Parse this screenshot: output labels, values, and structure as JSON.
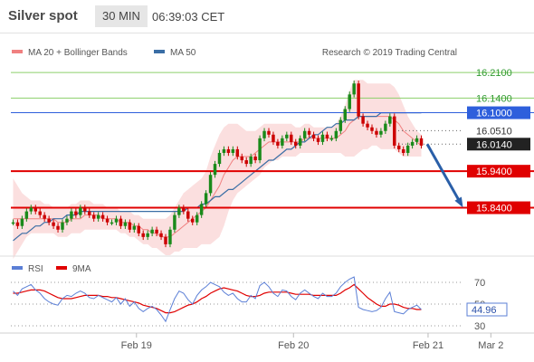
{
  "header": {
    "title": "Silver spot",
    "timeframe": "30 MIN",
    "time": "06:39:03 CET"
  },
  "credit": "Research © 2019 Trading Central",
  "colors": {
    "bollinger": "#f08080",
    "ma50": "#3a6ea5",
    "resistance": "#2e5fdc",
    "support": "#e00000",
    "target_line": "#8ccf6a",
    "candle_up": "#1a8a1a",
    "candle_down": "#cc0000",
    "rsi": "#5b7fd6",
    "rsi_ma": "#e00000"
  },
  "chart_data": [
    {
      "type": "candlestick",
      "legend": [
        {
          "name": "MA 20 + Bollinger Bands",
          "color": "#f08080"
        },
        {
          "name": "MA 50",
          "color": "#3a6ea5"
        }
      ],
      "ylim": [
        15.72,
        16.245
      ],
      "x_ticks": [
        "Feb 19",
        "Feb 20",
        "Feb 21",
        "Mar 2"
      ],
      "levels": [
        {
          "value": 16.21,
          "label": "16.2100",
          "kind": "target"
        },
        {
          "value": 16.14,
          "label": "16.1400",
          "kind": "target"
        },
        {
          "value": 16.1,
          "label": "16.1000",
          "kind": "resistance"
        },
        {
          "value": 16.051,
          "label": "16.0510",
          "kind": "dotted"
        },
        {
          "value": 16.014,
          "label": "16.0140",
          "kind": "last"
        },
        {
          "value": 15.94,
          "label": "15.9400",
          "kind": "support"
        },
        {
          "value": 15.84,
          "label": "15.8400",
          "kind": "support"
        }
      ],
      "close": [
        15.8,
        15.79,
        15.81,
        15.83,
        15.84,
        15.83,
        15.82,
        15.81,
        15.8,
        15.79,
        15.78,
        15.8,
        15.81,
        15.83,
        15.82,
        15.84,
        15.83,
        15.82,
        15.81,
        15.82,
        15.81,
        15.8,
        15.8,
        15.81,
        15.79,
        15.8,
        15.78,
        15.79,
        15.77,
        15.76,
        15.77,
        15.78,
        15.77,
        15.76,
        15.74,
        15.78,
        15.82,
        15.84,
        15.83,
        15.81,
        15.8,
        15.82,
        15.85,
        15.88,
        15.93,
        15.96,
        15.99,
        16.0,
        15.99,
        16.0,
        15.98,
        15.97,
        15.96,
        15.98,
        15.97,
        16.03,
        16.05,
        16.04,
        16.02,
        16.01,
        16.03,
        16.04,
        16.02,
        16.01,
        16.03,
        16.05,
        16.04,
        16.03,
        16.02,
        16.04,
        16.03,
        16.03,
        16.05,
        16.08,
        16.11,
        16.15,
        16.18,
        16.09,
        16.07,
        16.06,
        16.05,
        16.04,
        16.05,
        16.07,
        16.09,
        16.01,
        16.0,
        15.99,
        16.01,
        16.02,
        16.03,
        16.01
      ],
      "bollinger_upper": [
        15.92,
        15.9,
        15.88,
        15.87,
        15.86,
        15.86,
        15.86,
        15.85,
        15.85,
        15.84,
        15.84,
        15.84,
        15.84,
        15.85,
        15.85,
        15.86,
        15.86,
        15.86,
        15.85,
        15.85,
        15.85,
        15.84,
        15.84,
        15.84,
        15.83,
        15.83,
        15.83,
        15.82,
        15.82,
        15.81,
        15.81,
        15.81,
        15.81,
        15.81,
        15.81,
        15.82,
        15.84,
        15.86,
        15.88,
        15.89,
        15.9,
        15.91,
        15.92,
        15.94,
        15.98,
        16.01,
        16.04,
        16.06,
        16.07,
        16.07,
        16.07,
        16.06,
        16.05,
        16.05,
        16.05,
        16.06,
        16.07,
        16.07,
        16.07,
        16.07,
        16.07,
        16.07,
        16.07,
        16.06,
        16.06,
        16.07,
        16.07,
        16.06,
        16.06,
        16.06,
        16.06,
        16.06,
        16.07,
        16.09,
        16.12,
        16.16,
        16.19,
        16.19,
        16.19,
        16.18,
        16.18,
        16.18,
        16.18,
        16.18,
        16.18,
        16.17,
        16.15,
        16.12,
        16.09,
        16.07,
        16.05,
        16.04
      ],
      "bollinger_lower": [
        15.7,
        15.72,
        15.74,
        15.76,
        15.77,
        15.77,
        15.77,
        15.77,
        15.77,
        15.77,
        15.76,
        15.76,
        15.76,
        15.77,
        15.77,
        15.77,
        15.78,
        15.78,
        15.78,
        15.78,
        15.78,
        15.78,
        15.78,
        15.78,
        15.77,
        15.77,
        15.76,
        15.76,
        15.75,
        15.74,
        15.74,
        15.73,
        15.73,
        15.72,
        15.71,
        15.71,
        15.72,
        15.72,
        15.73,
        15.73,
        15.73,
        15.73,
        15.74,
        15.74,
        15.74,
        15.75,
        15.76,
        15.79,
        15.83,
        15.86,
        15.88,
        15.89,
        15.9,
        15.91,
        15.92,
        15.93,
        15.95,
        15.96,
        15.97,
        15.97,
        15.98,
        15.98,
        15.98,
        15.98,
        15.99,
        15.99,
        15.99,
        15.99,
        15.99,
        15.99,
        15.99,
        15.99,
        15.99,
        15.99,
        15.98,
        15.98,
        15.98,
        15.99,
        16.0,
        16.0,
        16.01,
        16.01,
        16.0,
        16.0,
        16.0,
        16.0,
        15.99,
        15.98,
        15.98,
        15.98,
        15.98,
        15.98
      ],
      "ma20": [
        15.81,
        15.81,
        15.81,
        15.81,
        15.81,
        15.81,
        15.81,
        15.81,
        15.81,
        15.81,
        15.8,
        15.8,
        15.8,
        15.81,
        15.81,
        15.81,
        15.82,
        15.82,
        15.82,
        15.82,
        15.81,
        15.81,
        15.81,
        15.81,
        15.8,
        15.8,
        15.8,
        15.79,
        15.79,
        15.78,
        15.78,
        15.77,
        15.77,
        15.76,
        15.76,
        15.76,
        15.77,
        15.78,
        15.79,
        15.8,
        15.81,
        15.82,
        15.83,
        15.84,
        15.86,
        15.88,
        15.9,
        15.93,
        15.95,
        15.97,
        15.98,
        15.98,
        15.98,
        15.98,
        15.99,
        16.0,
        16.01,
        16.02,
        16.02,
        16.02,
        16.02,
        16.02,
        16.02,
        16.02,
        16.02,
        16.03,
        16.03,
        16.03,
        16.03,
        16.03,
        16.03,
        16.03,
        16.03,
        16.04,
        16.05,
        16.07,
        16.08,
        16.09,
        16.09,
        16.09,
        16.09,
        16.09,
        16.09,
        16.09,
        16.09,
        16.08,
        16.07,
        16.05,
        16.04,
        16.03,
        16.02,
        16.01
      ],
      "ma50": [
        15.75,
        15.76,
        15.77,
        15.77,
        15.78,
        15.79,
        15.79,
        15.8,
        15.8,
        15.81,
        15.81,
        15.81,
        15.82,
        15.82,
        15.82,
        15.83,
        15.83,
        15.83,
        15.83,
        15.83,
        15.83,
        15.83,
        15.83,
        15.83,
        15.83,
        15.83,
        15.83,
        15.83,
        15.83,
        15.83,
        15.83,
        15.83,
        15.83,
        15.83,
        15.83,
        15.83,
        15.83,
        15.83,
        15.83,
        15.84,
        15.84,
        15.84,
        15.85,
        15.85,
        15.86,
        15.87,
        15.87,
        15.88,
        15.89,
        15.89,
        15.9,
        15.91,
        15.92,
        15.93,
        15.94,
        15.95,
        15.96,
        15.97,
        15.97,
        15.98,
        15.99,
        16.0,
        16.0,
        16.01,
        16.02,
        16.02,
        16.03,
        16.04,
        16.04,
        16.05,
        16.06,
        16.06,
        16.07,
        16.07,
        16.08,
        16.08,
        16.08,
        16.09,
        16.09,
        16.09,
        16.09,
        16.09,
        16.1,
        16.1,
        16.1,
        16.1,
        16.1,
        16.1,
        16.1,
        16.1,
        16.1,
        16.1
      ],
      "forecast": {
        "from": 16.014,
        "to": 15.84
      }
    },
    {
      "type": "line",
      "legend": [
        {
          "name": "RSI",
          "color": "#5b7fd6"
        },
        {
          "name": "9MA",
          "color": "#e00000"
        }
      ],
      "ylim": [
        20,
        80
      ],
      "y_ticks": [
        70,
        50,
        30
      ],
      "current_label": "44.96",
      "rsi": [
        62,
        58,
        64,
        66,
        68,
        63,
        60,
        55,
        52,
        50,
        49,
        55,
        58,
        57,
        60,
        62,
        60,
        56,
        55,
        58,
        56,
        54,
        52,
        56,
        50,
        55,
        48,
        52,
        46,
        43,
        46,
        48,
        45,
        40,
        34,
        45,
        55,
        62,
        60,
        54,
        50,
        58,
        63,
        66,
        70,
        68,
        66,
        61,
        58,
        60,
        55,
        52,
        52,
        58,
        55,
        67,
        70,
        66,
        60,
        57,
        63,
        62,
        57,
        54,
        60,
        63,
        60,
        57,
        55,
        60,
        57,
        57,
        60,
        66,
        70,
        73,
        75,
        47,
        45,
        44,
        43,
        44,
        47,
        55,
        61,
        43,
        42,
        41,
        45,
        47,
        49,
        45
      ],
      "rsi_ma": [
        60,
        60,
        61,
        62,
        63,
        63,
        63,
        62,
        60,
        58,
        56,
        55,
        55,
        55,
        56,
        57,
        58,
        58,
        58,
        58,
        57,
        57,
        56,
        56,
        55,
        54,
        53,
        52,
        51,
        49,
        48,
        47,
        46,
        44,
        42,
        42,
        43,
        45,
        47,
        49,
        50,
        52,
        55,
        57,
        60,
        62,
        64,
        65,
        64,
        63,
        62,
        60,
        58,
        57,
        57,
        58,
        60,
        61,
        61,
        61,
        61,
        61,
        60,
        59,
        59,
        59,
        59,
        58,
        58,
        58,
        58,
        58,
        58,
        60,
        63,
        65,
        68,
        64,
        60,
        56,
        53,
        50,
        48,
        48,
        50,
        50,
        49,
        47,
        46,
        46,
        45,
        45
      ]
    }
  ]
}
